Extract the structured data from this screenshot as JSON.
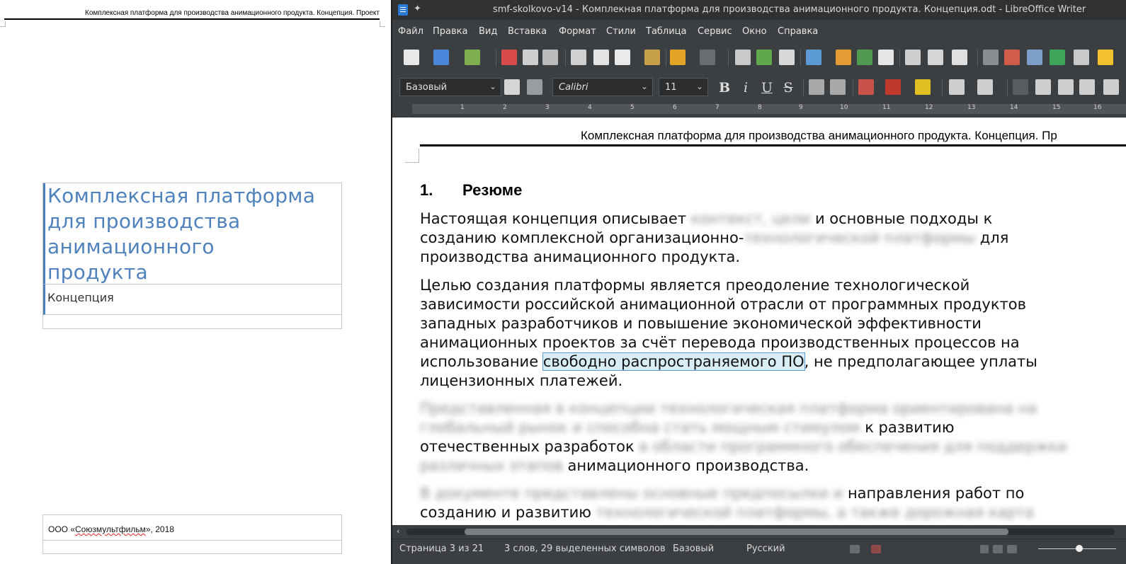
{
  "left_page": {
    "header_text": "Комплексная платформа для производства анимационного продукта. Концепция. Проект",
    "title_lines": [
      "Комплексная платформа",
      "для производства",
      "анимационного",
      "продукта"
    ],
    "subtitle": "Концепция",
    "footer_prefix": "ООО «",
    "footer_misspelled": "Союзмультфильм",
    "footer_suffix": "», 2018"
  },
  "window": {
    "title": "smf-skolkovo-v14 - Комплекная платформа для производства анимационного продукта. Концепция.odt - LibreOffice Writer"
  },
  "menubar": {
    "items": [
      "Файл",
      "Правка",
      "Вид",
      "Вставка",
      "Формат",
      "Стили",
      "Таблица",
      "Сервис",
      "Окно",
      "Справка"
    ]
  },
  "formatting": {
    "paragraph_style": "Базовый",
    "font_name": "Calibri",
    "font_size": "11",
    "bold": "B",
    "italic": "i",
    "underline": "U",
    "strikethrough": "S"
  },
  "ruler": {
    "numbers": [
      "1",
      "2",
      "3",
      "4",
      "5",
      "6",
      "7",
      "8",
      "9",
      "10",
      "11",
      "12",
      "13",
      "14",
      "15",
      "16"
    ]
  },
  "document": {
    "header": "Комплексная платформа для производства анимационного продукта. Концепция. Пр",
    "heading_number": "1.",
    "heading_title": "Резюме",
    "p1": {
      "l1a": "Настоящая концепция описывает ",
      "l1b": "контекст, цели",
      "l1c": " и основные подходы к",
      "l2a": "созданию комплексной организационно-",
      "l2b": "технологической платформы",
      "l2c": " для",
      "l3": "производства анимационного продукта."
    },
    "p2": {
      "l1": "Целью создания платформы является преодоление технологической",
      "l2": "зависимости российской анимационной отрасли от программных продуктов",
      "l3": "западных разработчиков и повышение экономической эффективности",
      "l4": "анимационных проектов за счёт перевода производственных процессов на",
      "l5a": "использование ",
      "l5sel": "свободно распространяемого ПО",
      "l5b": ", не предполагающее уплаты",
      "l6": "лицензионных платежей."
    },
    "p3": {
      "l1": "Представленная в концепции технологическая платформа ориентирована на",
      "l2a": "глобальный рынок и способна стать мощным стимулом",
      "l2b": " к развитию",
      "l3a": "отечественных разработок ",
      "l3b": "в области программного обеспечения для поддержки",
      "l4a": "различных этапов",
      "l4b": " анимационного производства."
    },
    "p4": {
      "l1a": "В документе представлены основные предпосылки и",
      "l1b": " направления работ по",
      "l2a": "созданию и развитию ",
      "l2b": "технологической платформы, а также дорожная карта"
    }
  },
  "statusbar": {
    "page": "Страница 3 из 21",
    "words": "3 слов, 29 выделенных символов",
    "style": "Базовый",
    "language": "Русский"
  }
}
